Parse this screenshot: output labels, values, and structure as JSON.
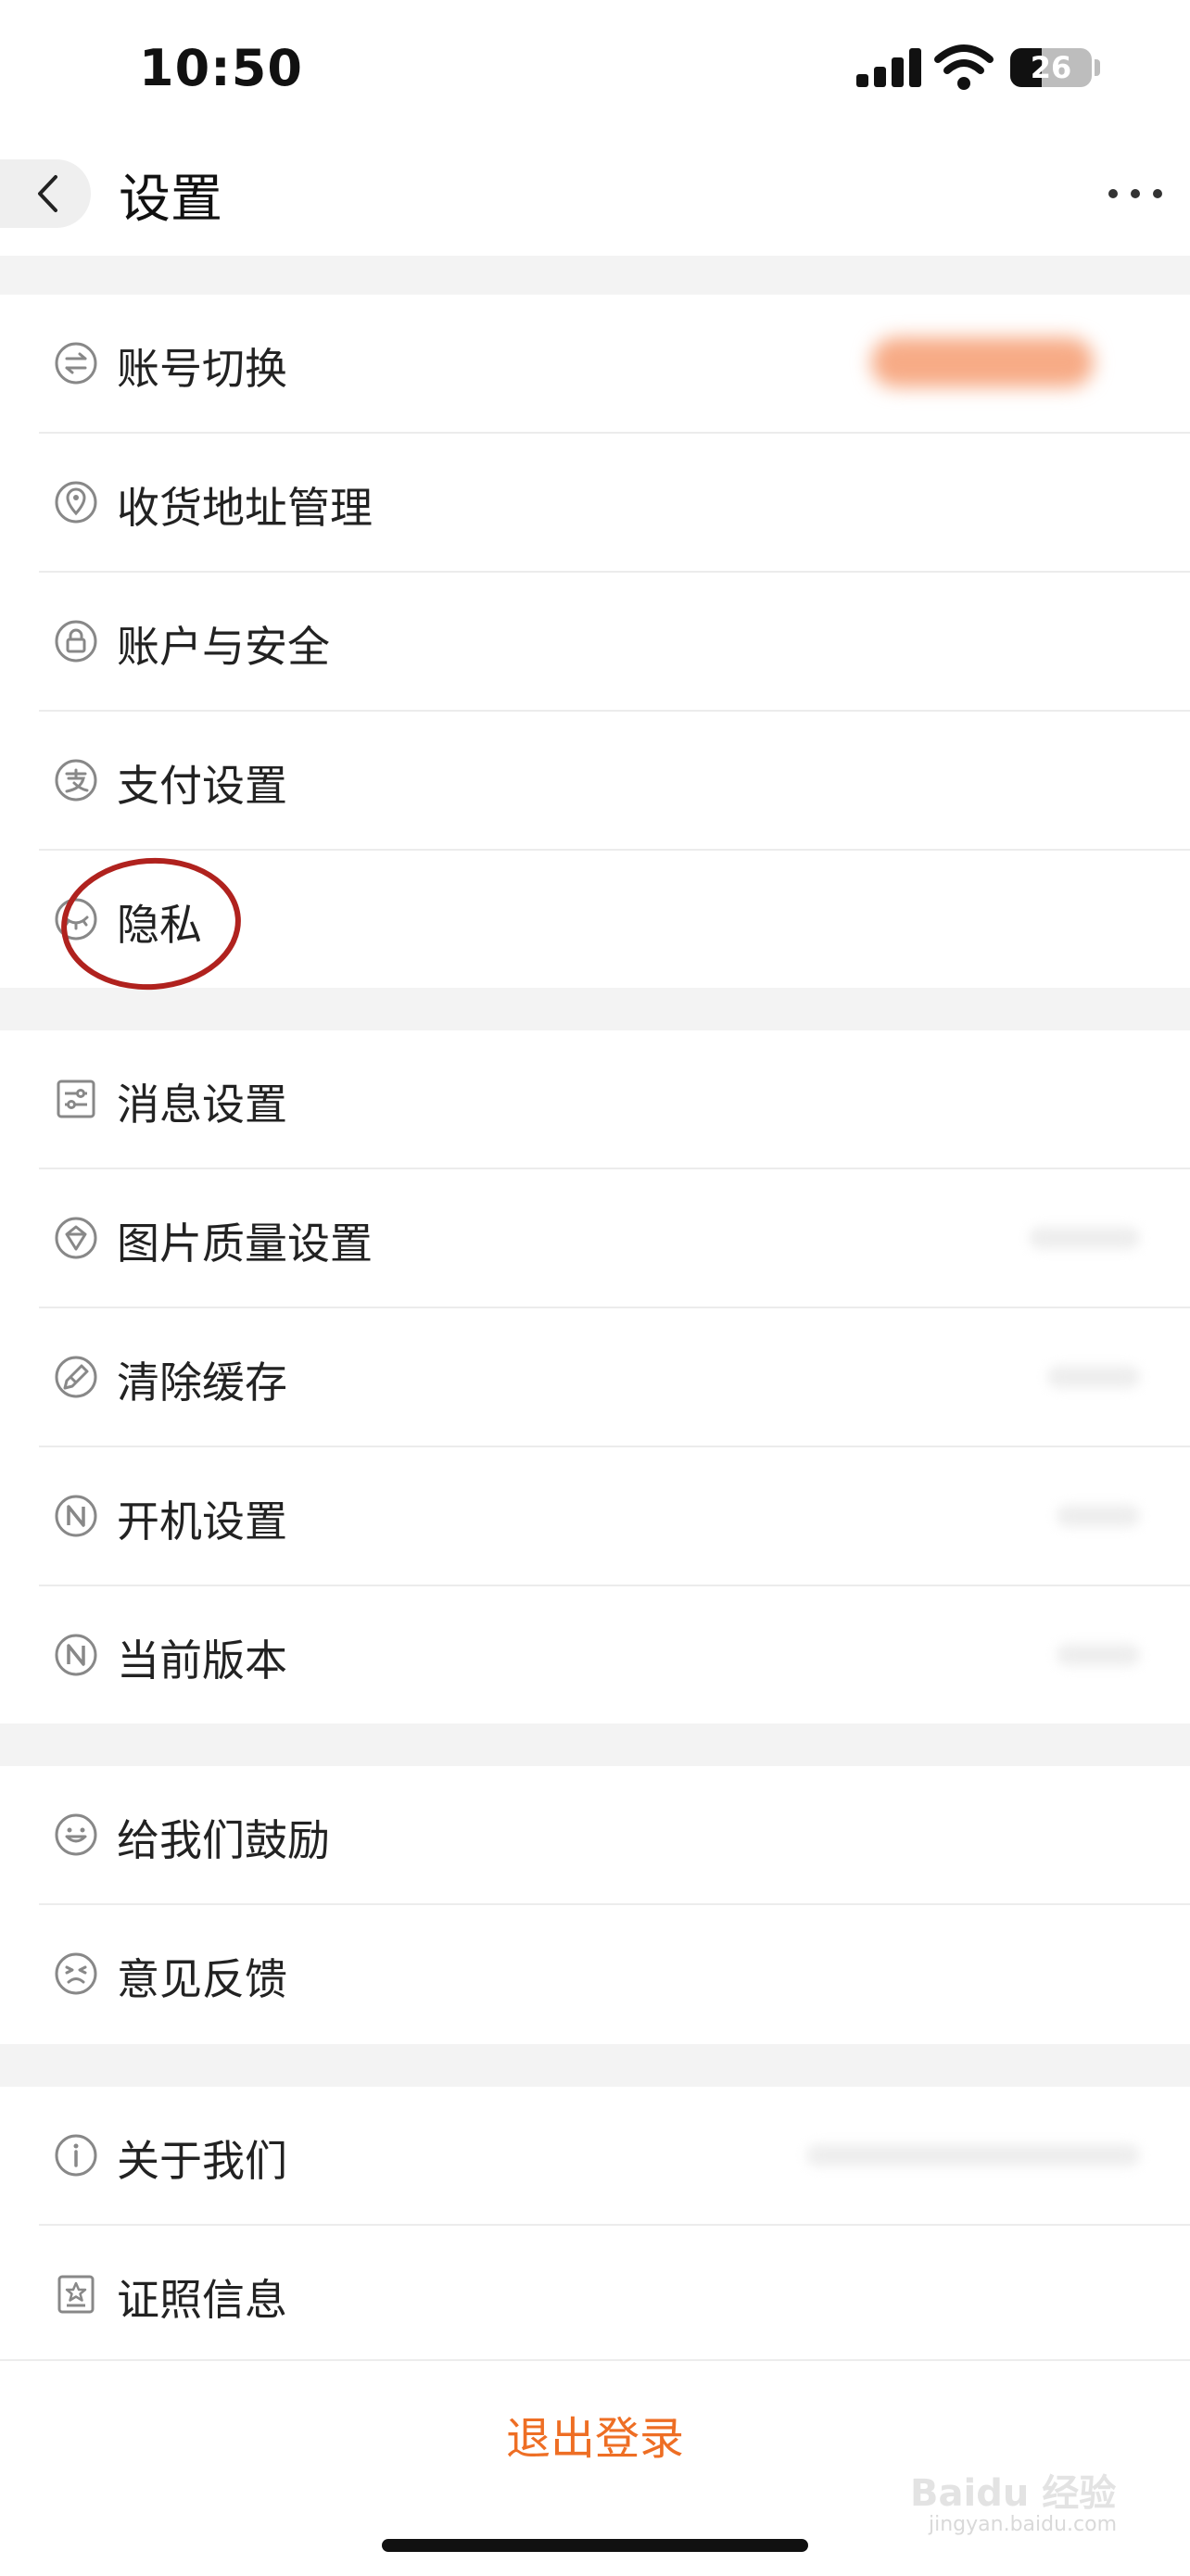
{
  "status_bar": {
    "time": "10:50",
    "battery": "26"
  },
  "nav": {
    "title": "设置"
  },
  "groups": [
    {
      "items": [
        {
          "name": "account-switch",
          "label": "账号切换",
          "icon": "swap-icon"
        },
        {
          "name": "address-management",
          "label": "收货地址管理",
          "icon": "location-pin-icon"
        },
        {
          "name": "account-security",
          "label": "账户与安全",
          "icon": "lock-icon"
        },
        {
          "name": "payment-settings",
          "label": "支付设置",
          "icon": "alipay-icon"
        },
        {
          "name": "privacy",
          "label": "隐私",
          "icon": "eye-closed-icon"
        }
      ]
    },
    {
      "items": [
        {
          "name": "message-settings",
          "label": "消息设置",
          "icon": "sliders-icon"
        },
        {
          "name": "image-quality",
          "label": "图片质量设置",
          "icon": "image-quality-icon"
        },
        {
          "name": "clear-cache",
          "label": "清除缓存",
          "icon": "broom-icon"
        },
        {
          "name": "startup-settings",
          "label": "开机设置",
          "icon": "n-circle-icon"
        },
        {
          "name": "current-version",
          "label": "当前版本",
          "icon": "n-circle-icon"
        }
      ]
    },
    {
      "items": [
        {
          "name": "encourage-us",
          "label": "给我们鼓励",
          "icon": "smile-icon"
        },
        {
          "name": "feedback",
          "label": "意见反馈",
          "icon": "frown-icon"
        }
      ]
    },
    {
      "items": [
        {
          "name": "about-us",
          "label": "关于我们",
          "icon": "info-icon"
        },
        {
          "name": "license-info",
          "label": "证照信息",
          "icon": "certificate-icon"
        }
      ]
    }
  ],
  "footer": {
    "logout_label": "退出登录"
  },
  "watermark": {
    "brand": "Baidu 经验",
    "url": "jingyan.baidu.com"
  },
  "colors": {
    "accent": "#ee6e24",
    "highlight_circle": "#b0221e"
  }
}
